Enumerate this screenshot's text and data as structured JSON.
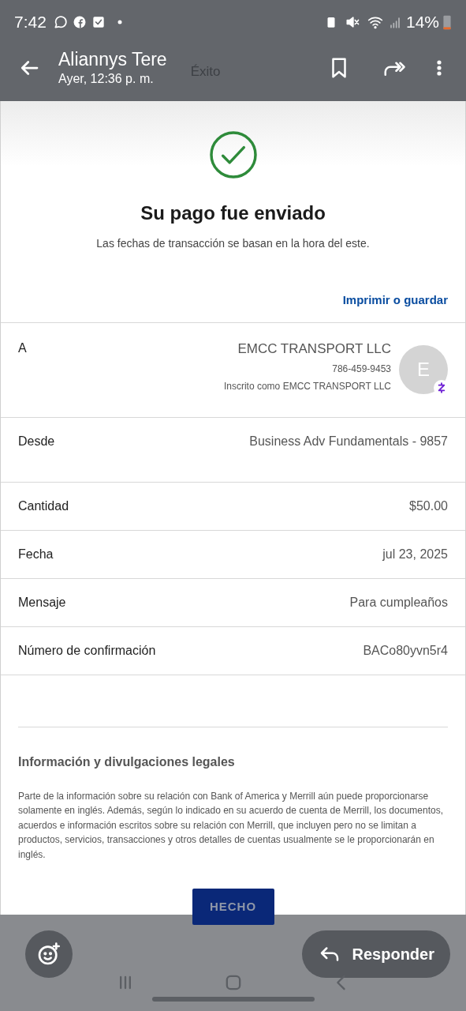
{
  "status_bar": {
    "time": "7:42",
    "battery": "14%"
  },
  "header": {
    "title": "Aliannys Tere",
    "subtitle": "Ayer, 12:36 p. m.",
    "page_title": "Éxito"
  },
  "success": {
    "title": "Su pago fue enviado",
    "subtitle": "Las fechas de transacción se basan en la hora del este."
  },
  "print_link": "Imprimir o guardar",
  "recipient": {
    "label": "A",
    "name": "EMCC TRANSPORT LLC",
    "phone": "786-459-9453",
    "enrolled": "Inscrito como EMCC TRANSPORT LLC",
    "avatar_initial": "E"
  },
  "details": [
    {
      "label": "Desde",
      "value": "Business Adv Fundamentals - 9857"
    },
    {
      "label": "Cantidad",
      "value": "$50.00"
    },
    {
      "label": "Fecha",
      "value": "jul 23, 2025"
    },
    {
      "label": "Mensaje",
      "value": "Para cumpleaños"
    },
    {
      "label": "Número de confirmación",
      "value": "BACo80yvn5r4"
    }
  ],
  "legal": {
    "title": "Información y divulgaciones legales",
    "body": "Parte de la información sobre su relación con Bank of America y Merrill aún puede proporcionarse solamente en inglés. Además, según lo indicado en su acuerdo de cuenta de Merrill, los documentos, acuerdos e información escritos sobre su relación con Merrill, que incluyen pero no se limitan a productos, servicios, transacciones y otros detalles de cuentas usualmente se le proporcionarán en inglés."
  },
  "done_button": "HECHO",
  "reply_button": "Responder"
}
